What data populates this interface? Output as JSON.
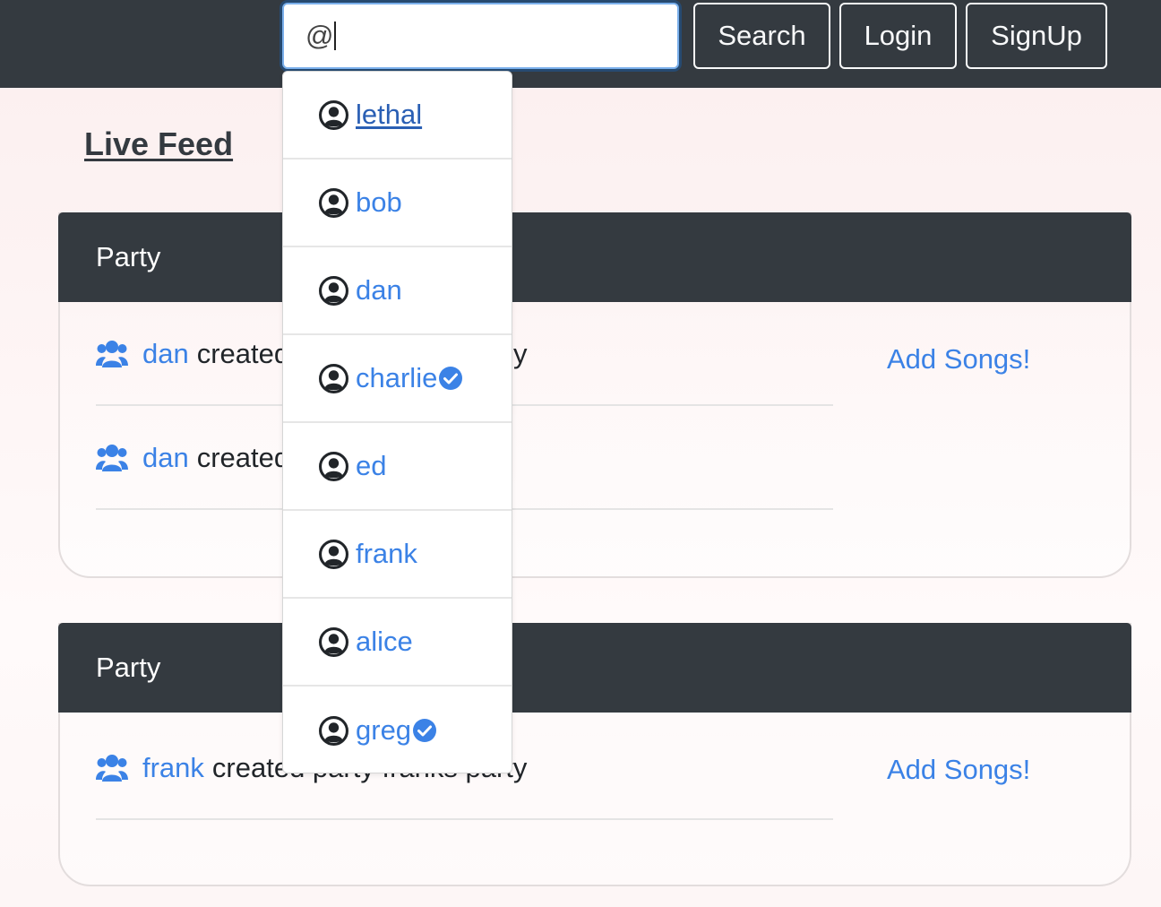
{
  "navbar": {
    "search_value": "@",
    "search_button": "Search",
    "login_button": "Login",
    "signup_button": "SignUp"
  },
  "live_feed_title": "Live Feed",
  "cards": [
    {
      "header": "Party",
      "rows": [
        {
          "user": "dan",
          "text": "created party",
          "tail": "y",
          "action": "Add Songs!"
        },
        {
          "user": "dan",
          "text": "created"
        }
      ]
    },
    {
      "header": "Party",
      "rows": [
        {
          "user": "frank",
          "text": "created party franks party",
          "action": "Add Songs!"
        }
      ]
    }
  ],
  "dropdown": {
    "items": [
      {
        "name": "lethal",
        "verified": false,
        "hovered": true
      },
      {
        "name": "bob",
        "verified": false
      },
      {
        "name": "dan",
        "verified": false
      },
      {
        "name": "charlie",
        "verified": true
      },
      {
        "name": "ed",
        "verified": false
      },
      {
        "name": "frank",
        "verified": false
      },
      {
        "name": "alice",
        "verified": false
      },
      {
        "name": "greg",
        "verified": true
      }
    ]
  },
  "colors": {
    "navbar": "#343a40",
    "link": "#3b82e6",
    "verified": "#3b82e6"
  },
  "icons": {
    "user": "user-circle-icon",
    "group": "users-group-icon",
    "verified": "verified-check-icon"
  }
}
